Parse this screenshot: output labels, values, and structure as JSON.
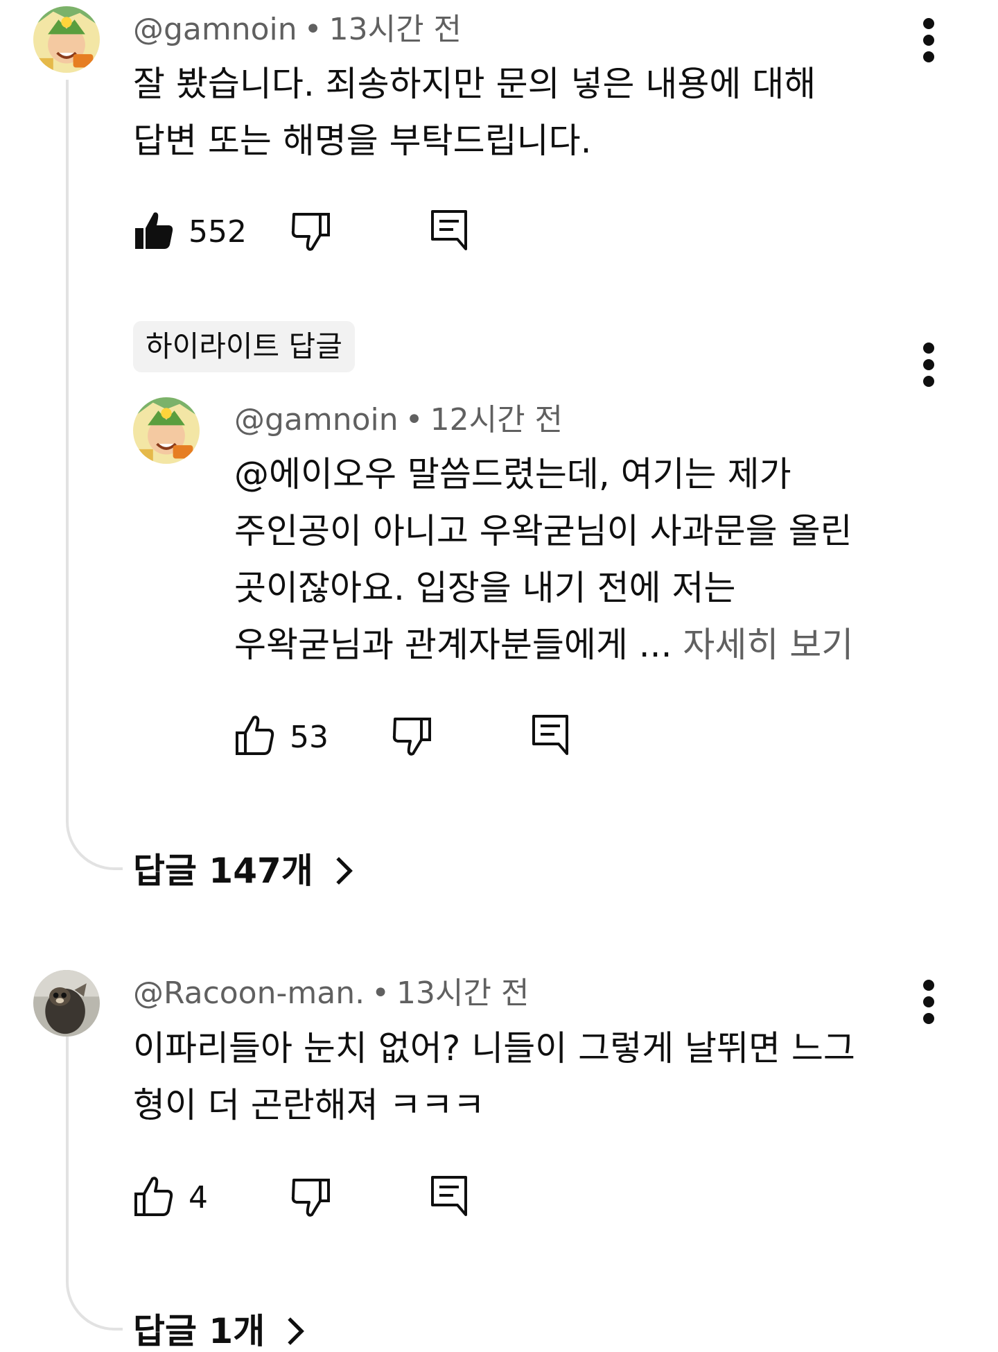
{
  "comments": [
    {
      "handle": "@gamnoin",
      "dot": "•",
      "time": "13시간 전",
      "text_lines": [
        "잘 봤습니다. 죄송하지만 문의 넣은 내용에 대해",
        "답변 또는 해명을 부탁드립니다."
      ],
      "likes": "552",
      "liked": true,
      "highlight_chip": "하이라이트 답글",
      "reply": {
        "handle": "@gamnoin",
        "dot": "•",
        "time": "12시간 전",
        "text_lines": [
          "@에이오우 말씀드렸는데, 여기는 제가",
          "주인공이 아니고 우왁굳님이 사과문을 올린",
          "곳이잖아요. 입장을 내기 전에 저는",
          "우왁굳님과 관계자분들에게 ... "
        ],
        "more_label": "자세히 보기",
        "likes": "53"
      },
      "replies_label": "답글 147개"
    },
    {
      "handle": "@Racoon-man.",
      "dot": "•",
      "time": "13시간 전",
      "text_lines": [
        "이파리들아 눈치 없어? 니들이 그렇게 날뛰면 느그",
        "형이 더 곤란해져 ㅋㅋㅋ"
      ],
      "likes": "4",
      "liked": false,
      "replies_label": "답글 1개"
    }
  ],
  "icons": {
    "like": "thumbs-up-icon",
    "like_filled": "thumbs-up-filled-icon",
    "dislike": "thumbs-down-icon",
    "reply": "reply-comment-icon",
    "menu": "more-vert-icon",
    "chevron": "chevron-right-icon"
  },
  "colors": {
    "text": "#0f0f0f",
    "secondary": "#606060",
    "chip_bg": "#f2f2f2",
    "thread_line": "#e2e2e2"
  }
}
